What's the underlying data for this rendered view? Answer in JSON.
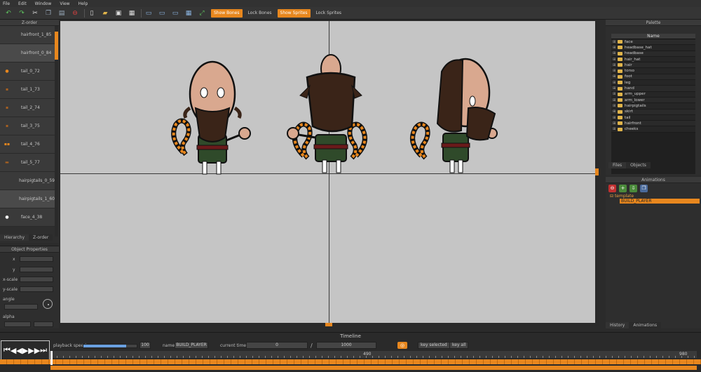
{
  "menu": [
    "File",
    "Edit",
    "Window",
    "View",
    "Help"
  ],
  "toolbar": {
    "show_bones": "Show Bones",
    "lock_bones": "Lock Bones",
    "show_sprites": "Show Sprites",
    "lock_sprites": "Lock Sprites"
  },
  "zorder": {
    "title": "Z-order",
    "items": [
      "hairfront_1_85",
      "hairfront_0_84",
      "tail_0_72",
      "tail_1_73",
      "tail_2_74",
      "tail_3_75",
      "tail_4_76",
      "tail_5_77",
      "hairpigtails_0_59",
      "hairpigtails_1_60",
      "face_4_38"
    ],
    "tabs": [
      "Hierarchy",
      "Z-order"
    ]
  },
  "object_properties": {
    "title": "Object Properties",
    "fields": [
      "x",
      "y",
      "x-scale",
      "y-scale",
      "angle",
      "alpha"
    ]
  },
  "palette": {
    "title": "Palette",
    "column": "Name",
    "items": [
      "face",
      "headbase_hat",
      "headbase",
      "hair_hat",
      "hair",
      "torso",
      "foot",
      "leg",
      "hand",
      "arm_upper",
      "arm_lower",
      "hairpigtails",
      "skirt",
      "tail",
      "hairfront",
      "cheeks"
    ],
    "tabs": [
      "Files",
      "Objects"
    ]
  },
  "animations": {
    "title": "Animations",
    "tree_root": "template",
    "tree_child": "BUILD_PLAYER",
    "tabs": [
      "History",
      "Animations"
    ]
  },
  "timeline": {
    "title": "Timeline",
    "playback_label": "playback speed:",
    "playback_value": "100",
    "playback_fraction": 0.8,
    "name_label": "name:",
    "name_value": "BUILD_PLAYER",
    "current_label": "current time:",
    "current_value": "0",
    "slash": "/",
    "total_value": "1000",
    "key_selected": "key selected",
    "key_all": "key all",
    "ruler_mid": "490",
    "ruler_end": "980"
  },
  "colors": {
    "accent": "#e8871e",
    "canvas": "#c5c5c5"
  }
}
